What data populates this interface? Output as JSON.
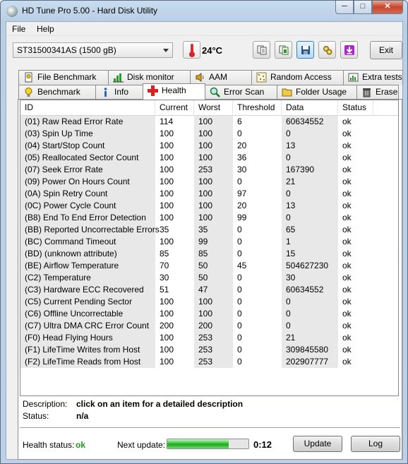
{
  "window": {
    "title": "HD Tune Pro 5.00 - Hard Disk Utility",
    "minimize": "─",
    "maximize": "□",
    "close": "✕"
  },
  "menu": {
    "file": "File",
    "help": "Help"
  },
  "toolbar": {
    "drive": "ST31500341AS (1500 gB)",
    "temperature": "24°C",
    "exit_label": "Exit",
    "buttons": [
      "copy-icon",
      "copy-info-icon",
      "save-icon",
      "settings-icon",
      "download-icon"
    ]
  },
  "tabs_top": [
    {
      "label": "File Benchmark",
      "icon": "file-benchmark-icon"
    },
    {
      "label": "Disk monitor",
      "icon": "disk-monitor-icon"
    },
    {
      "label": "AAM",
      "icon": "speaker-icon"
    },
    {
      "label": "Random Access",
      "icon": "random-access-icon"
    },
    {
      "label": "Extra tests",
      "icon": "extra-tests-icon"
    }
  ],
  "tabs_bottom": [
    {
      "label": "Benchmark",
      "icon": "lightbulb-icon"
    },
    {
      "label": "Info",
      "icon": "info-icon"
    },
    {
      "label": "Health",
      "icon": "health-cross-icon",
      "selected": true
    },
    {
      "label": "Error Scan",
      "icon": "magnifier-icon"
    },
    {
      "label": "Folder Usage",
      "icon": "folder-icon"
    },
    {
      "label": "Erase",
      "icon": "trash-icon"
    }
  ],
  "grid": {
    "columns": [
      "ID",
      "Current",
      "Worst",
      "Threshold",
      "Data",
      "Status"
    ],
    "rows": [
      [
        "(01) Raw Read Error Rate",
        "114",
        "100",
        "6",
        "60634552",
        "ok"
      ],
      [
        "(03) Spin Up Time",
        "100",
        "100",
        "0",
        "0",
        "ok"
      ],
      [
        "(04) Start/Stop Count",
        "100",
        "100",
        "20",
        "13",
        "ok"
      ],
      [
        "(05) Reallocated Sector Count",
        "100",
        "100",
        "36",
        "0",
        "ok"
      ],
      [
        "(07) Seek Error Rate",
        "100",
        "253",
        "30",
        "167390",
        "ok"
      ],
      [
        "(09) Power On Hours Count",
        "100",
        "100",
        "0",
        "21",
        "ok"
      ],
      [
        "(0A) Spin Retry Count",
        "100",
        "100",
        "97",
        "0",
        "ok"
      ],
      [
        "(0C) Power Cycle Count",
        "100",
        "100",
        "20",
        "13",
        "ok"
      ],
      [
        "(B8) End To End Error Detection",
        "100",
        "100",
        "99",
        "0",
        "ok"
      ],
      [
        "(BB) Reported Uncorrectable Errors",
        "35",
        "35",
        "0",
        "65",
        "ok"
      ],
      [
        "(BC) Command Timeout",
        "100",
        "99",
        "0",
        "1",
        "ok"
      ],
      [
        "(BD) (unknown attribute)",
        "85",
        "85",
        "0",
        "15",
        "ok"
      ],
      [
        "(BE) Airflow Temperature",
        "70",
        "50",
        "45",
        "504627230",
        "ok"
      ],
      [
        "(C2) Temperature",
        "30",
        "50",
        "0",
        "30",
        "ok"
      ],
      [
        "(C3) Hardware ECC Recovered",
        "51",
        "47",
        "0",
        "60634552",
        "ok"
      ],
      [
        "(C5) Current Pending Sector",
        "100",
        "100",
        "0",
        "0",
        "ok"
      ],
      [
        "(C6) Offline Uncorrectable",
        "100",
        "100",
        "0",
        "0",
        "ok"
      ],
      [
        "(C7) Ultra DMA CRC Error Count",
        "200",
        "200",
        "0",
        "0",
        "ok"
      ],
      [
        "(F0) Head Flying Hours",
        "100",
        "253",
        "0",
        "21",
        "ok"
      ],
      [
        "(F1) LifeTime Writes from Host",
        "100",
        "253",
        "0",
        "309845580",
        "ok"
      ],
      [
        "(F2) LifeTime Reads from Host",
        "100",
        "253",
        "0",
        "202907777",
        "ok"
      ]
    ]
  },
  "details": {
    "description_label": "Description:",
    "description_value": "click on an item for a detailed description",
    "status_label": "Status:",
    "status_value": "n/a"
  },
  "footer": {
    "health_label": "Health status:",
    "health_value": "ok",
    "next_update_label": "Next update:",
    "progress_fraction": 0.76,
    "countdown": "0:12",
    "update_label": "Update",
    "log_label": "Log"
  },
  "colors": {
    "ok_green": "#1d9a1d",
    "progress_green": "#35c335"
  }
}
